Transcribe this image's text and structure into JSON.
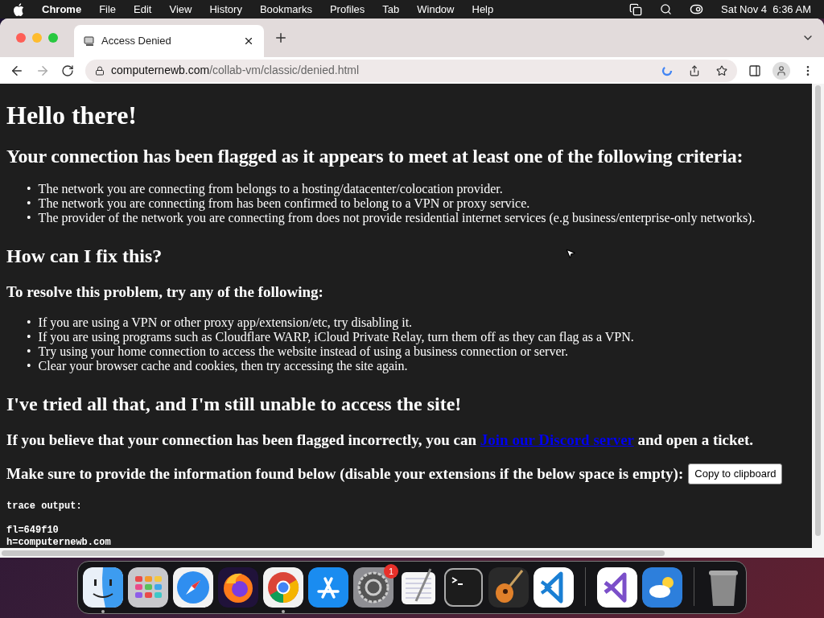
{
  "menu_bar": {
    "app": "Chrome",
    "menus": [
      "File",
      "Edit",
      "View",
      "History",
      "Bookmarks",
      "Profiles",
      "Tab",
      "Window",
      "Help"
    ],
    "clock": "Sat Nov 4  6:36 AM"
  },
  "tabs": [
    {
      "title": "Access Denied",
      "selected": true
    }
  ],
  "address_bar": {
    "domain": "computernewb.com",
    "path": "/collab-vm/classic/denied.html"
  },
  "page": {
    "title": "Hello there!",
    "criteria_heading": "Your connection has been flagged as it appears to meet at least one of the following criteria:",
    "criteria": [
      "The network you are connecting from belongs to a hosting/datacenter/colocation provider.",
      "The network you are connecting from has been confirmed to belong to a VPN or proxy service.",
      "The provider of the network you are connecting from does not provide residential internet services (e.g business/enterprise-only networks)."
    ],
    "fix_heading": "How can I fix this?",
    "fix_subheading": "To resolve this problem, try any of the following:",
    "fixes": [
      "If you are using a VPN or other proxy app/extension/etc, try disabling it.",
      "If you are using programs such as Cloudflare WARP, iCloud Private Relay, turn them off as they can flag as a VPN.",
      "Try using your home connection to access the website instead of using a business connection or server.",
      "Clear your browser cache and cookies, then try accessing the site again."
    ],
    "still_heading": "I've tried all that, and I'm still unable to access the site!",
    "contact_before": "If you believe that your connection has been flagged incorrectly, you can",
    "contact_link": "Join our Discord server",
    "contact_after": "and open a ticket.",
    "info_text": "Make sure to provide the information found below (disable your extensions if the below space is empty):",
    "copy_button": "Copy to clipboard",
    "bullet": "•",
    "trace_label": "trace output:",
    "trace": [
      "fl=649f10",
      "h=computernewb.com"
    ]
  },
  "dock": [
    {
      "kind": "finder",
      "running": true
    },
    {
      "kind": "launchpad",
      "running": false
    },
    {
      "kind": "safari",
      "running": false
    },
    {
      "kind": "firefox",
      "running": false
    },
    {
      "kind": "chrome",
      "running": true
    },
    {
      "kind": "appstore",
      "running": false
    },
    {
      "kind": "settings",
      "running": false,
      "badge": "1"
    },
    {
      "kind": "textedit",
      "running": false
    },
    {
      "kind": "terminal",
      "running": false
    },
    {
      "kind": "garageband",
      "running": false
    },
    {
      "kind": "vscode",
      "running": false
    },
    {
      "kind": "divider"
    },
    {
      "kind": "visualstudio",
      "running": false
    },
    {
      "kind": "weather",
      "running": false
    },
    {
      "kind": "divider"
    },
    {
      "kind": "trash",
      "running": false
    }
  ]
}
